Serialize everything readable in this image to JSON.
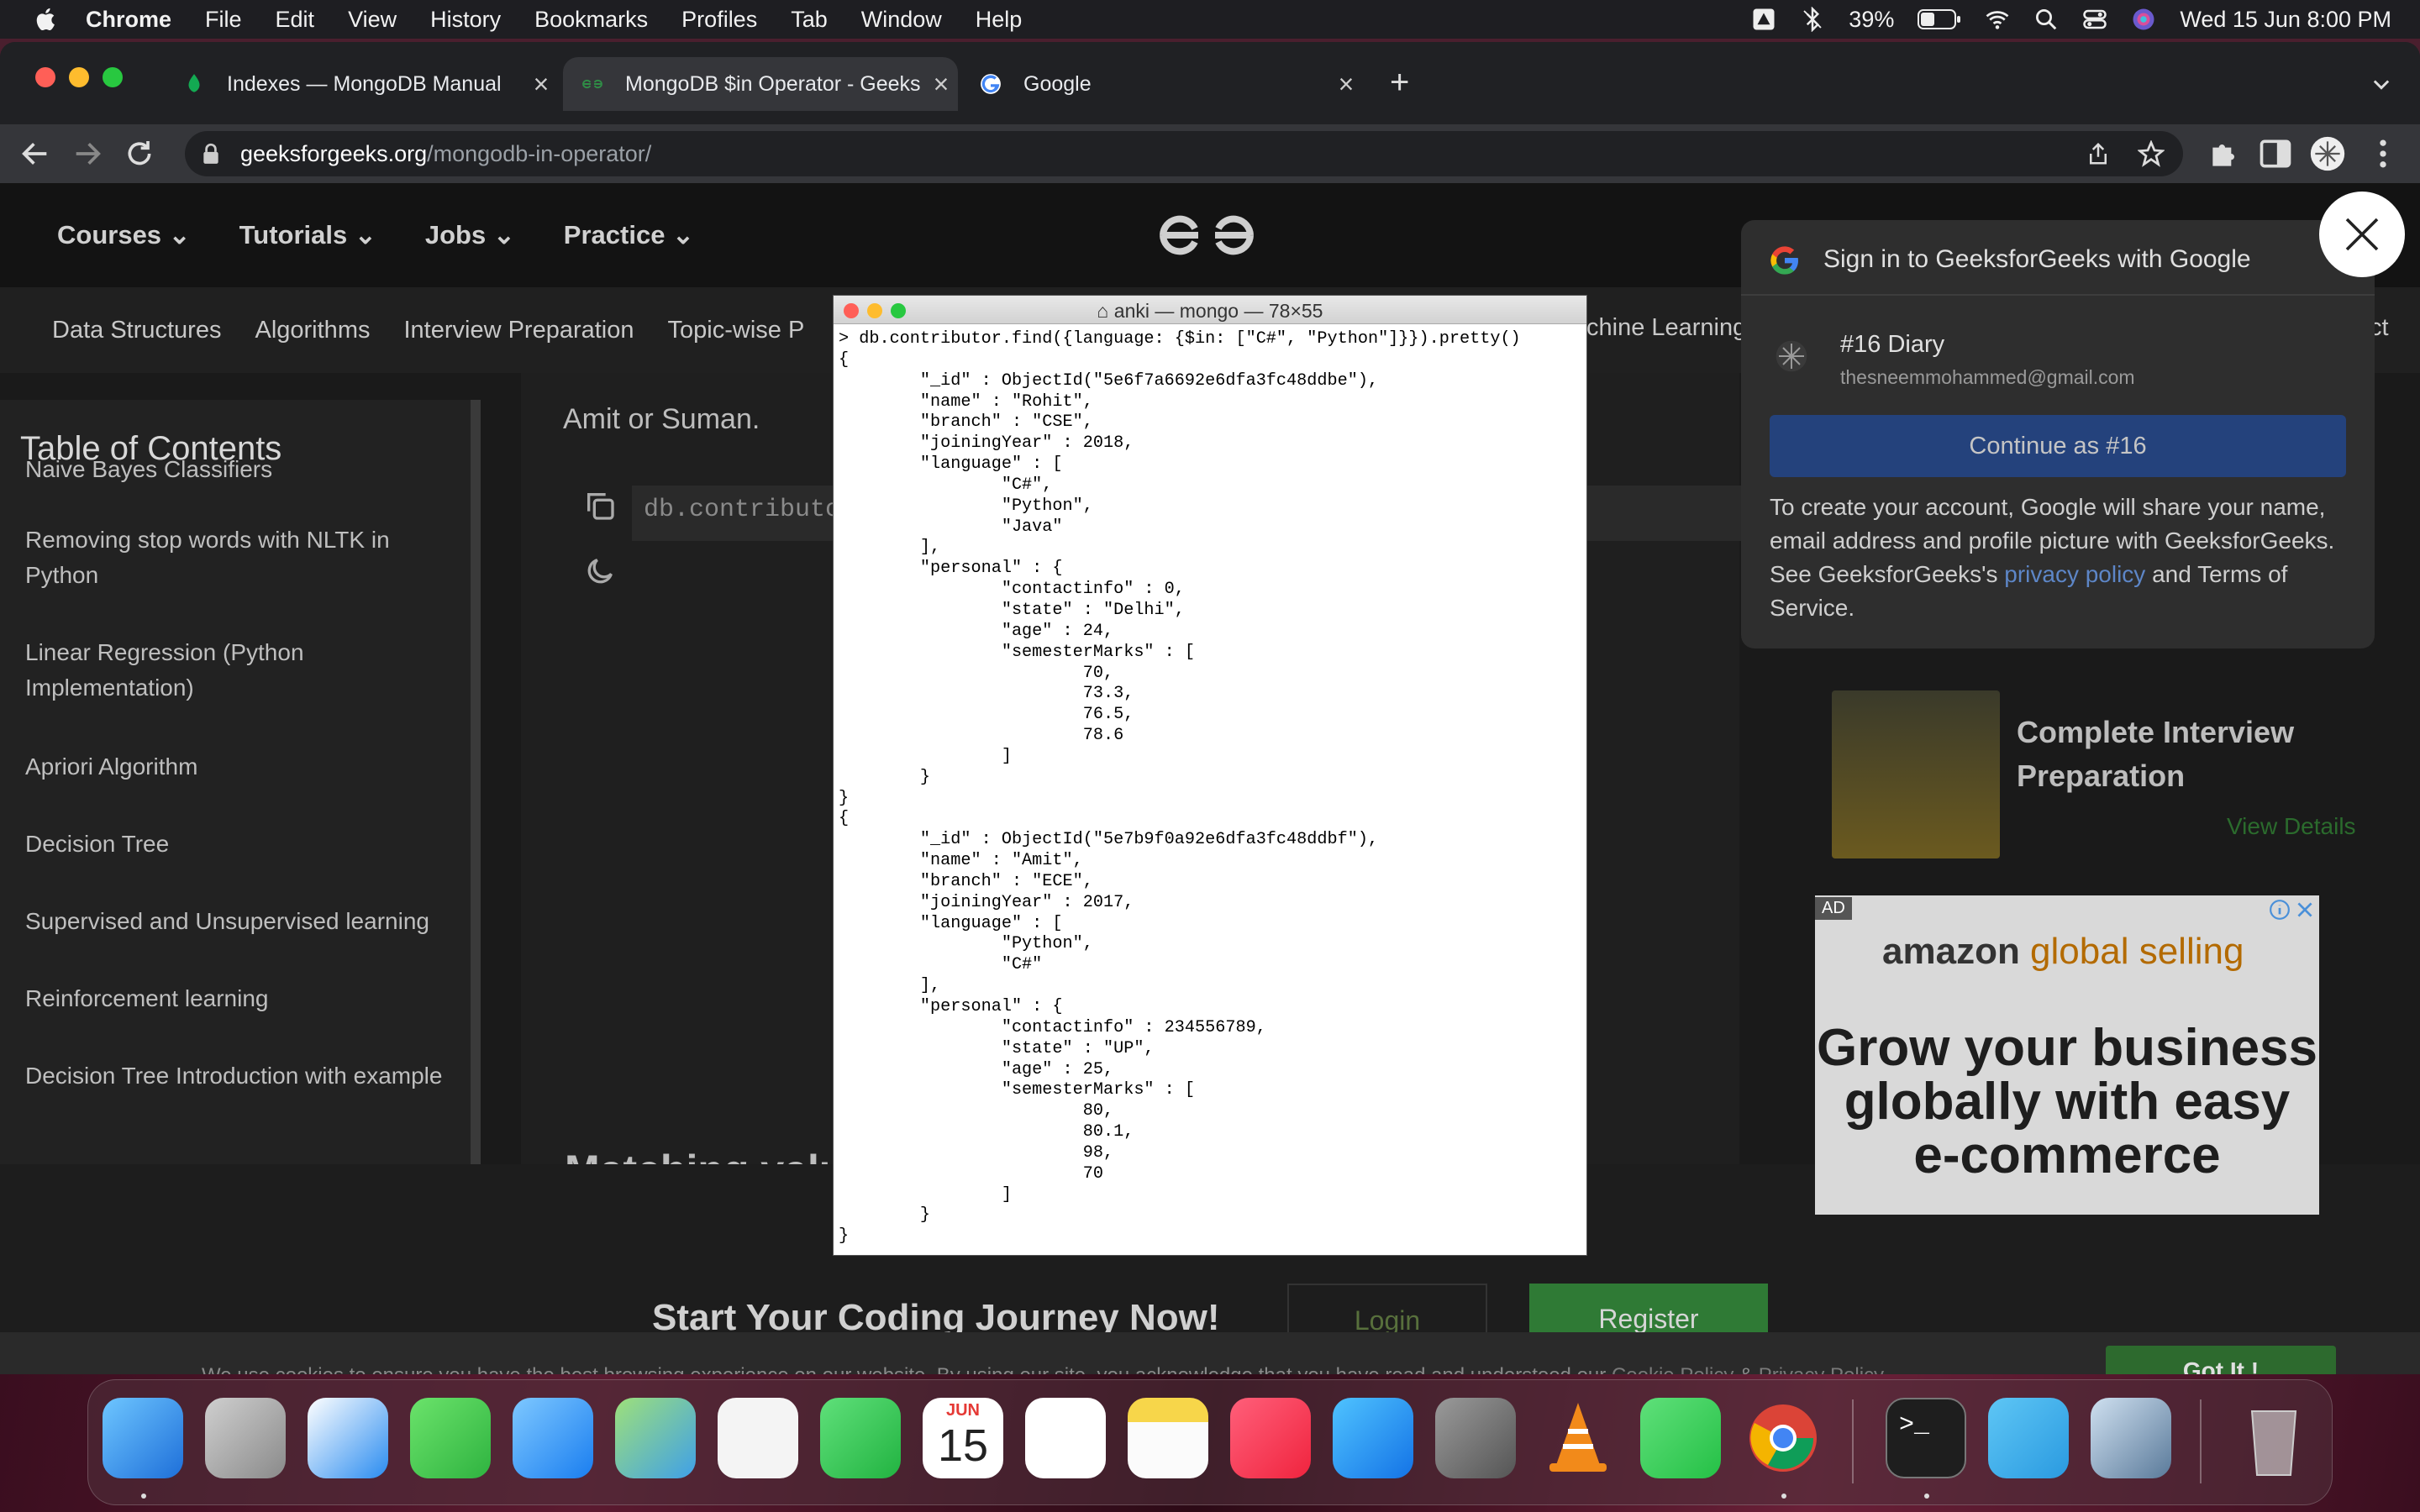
{
  "menubar": {
    "app": "Chrome",
    "items": [
      "File",
      "Edit",
      "View",
      "History",
      "Bookmarks",
      "Profiles",
      "Tab",
      "Window",
      "Help"
    ],
    "battery": "39%",
    "datetime": "Wed 15 Jun  8:00 PM"
  },
  "tabs": [
    {
      "title": "Indexes — MongoDB Manual",
      "close": "×"
    },
    {
      "title": "MongoDB $in Operator - Geeks",
      "close": "×"
    },
    {
      "title": "Google",
      "close": "×"
    }
  ],
  "new_tab": "+",
  "address": {
    "host": "geeksforgeeks.org",
    "path": "/mongodb-in-operator/"
  },
  "gfg_nav": [
    "Courses",
    "Tutorials",
    "Jobs",
    "Practice"
  ],
  "subnav": [
    "Data Structures",
    "Algorithms",
    "Interview Preparation",
    "Topic-wise P"
  ],
  "subnav_right": [
    "chine Learning",
    "ct"
  ],
  "toc": {
    "title": "Table of Contents",
    "items": [
      "Naive Bayes Classifiers",
      "Removing stop words with NLTK in Python",
      "Linear Regression (Python Implementation)",
      "Apriori Algorithm",
      "Decision Tree",
      "Supervised and Unsupervised learning",
      "Reinforcement learning",
      "Decision Tree Introduction with example"
    ]
  },
  "article": {
    "intro": "Amit or Suman.",
    "code_preview": "db.contributo",
    "matching": "Matching value"
  },
  "cta": {
    "title": "Start Your Coding Journey Now!",
    "login": "Login",
    "register": "Register"
  },
  "cookie": {
    "text": "We use cookies to ensure you have the best browsing experience on our website. By using our site, you acknowledge that you have read and understood our ",
    "policy": "Cookie Policy",
    "amp": " & ",
    "privacy": "Privacy Policy",
    "button": "Got It !"
  },
  "promo": {
    "title": "Complete Interview Preparation",
    "link": "View Details"
  },
  "ad": {
    "tag": "AD",
    "brand_a": "amazon",
    "brand_b": " global selling",
    "headline": "Grow your business globally with easy e-commerce"
  },
  "google_signin": {
    "header": "Sign in to GeeksforGeeks with Google",
    "name": "#16 Diary",
    "email": "thesneemmohammed@gmail.com",
    "continue": "Continue as #16",
    "disclaimer_a": "To create your account, Google will share your name, email address and profile picture with GeeksforGeeks. See GeeksforGeeks's ",
    "privacy": "privacy policy",
    "disclaimer_b": " and Terms of Service."
  },
  "terminal": {
    "title": "anki — mongo — 78×55",
    "output": "> db.contributor.find({language: {$in: [\"C#\", \"Python\"]}}).pretty()\n{\n        \"_id\" : ObjectId(\"5e6f7a6692e6dfa3fc48ddbe\"),\n        \"name\" : \"Rohit\",\n        \"branch\" : \"CSE\",\n        \"joiningYear\" : 2018,\n        \"language\" : [\n                \"C#\",\n                \"Python\",\n                \"Java\"\n        ],\n        \"personal\" : {\n                \"contactinfo\" : 0,\n                \"state\" : \"Delhi\",\n                \"age\" : 24,\n                \"semesterMarks\" : [\n                        70,\n                        73.3,\n                        76.5,\n                        78.6\n                ]\n        }\n}\n{\n        \"_id\" : ObjectId(\"5e7b9f0a92e6dfa3fc48ddbf\"),\n        \"name\" : \"Amit\",\n        \"branch\" : \"ECE\",\n        \"joiningYear\" : 2017,\n        \"language\" : [\n                \"Python\",\n                \"C#\"\n        ],\n        \"personal\" : {\n                \"contactinfo\" : 234556789,\n                \"state\" : \"UP\",\n                \"age\" : 25,\n                \"semesterMarks\" : [\n                        80,\n                        80.1,\n                        98,\n                        70\n                ]\n        }\n}"
  },
  "dock": {
    "calendar_month": "JUN",
    "calendar_day": "15",
    "apps": [
      "finder-icon",
      "launchpad-icon",
      "safari-icon",
      "messages-icon",
      "mail-icon",
      "maps-icon",
      "photos-icon",
      "facetime-icon",
      "calendar-icon",
      "reminders-icon",
      "notes-icon",
      "music-icon",
      "app-store-icon",
      "system-preferences-icon",
      "vlc-icon",
      "whatsapp-icon",
      "chrome-icon",
      "terminal-icon",
      "telegram-icon",
      "preview-icon",
      "trash-icon"
    ]
  }
}
